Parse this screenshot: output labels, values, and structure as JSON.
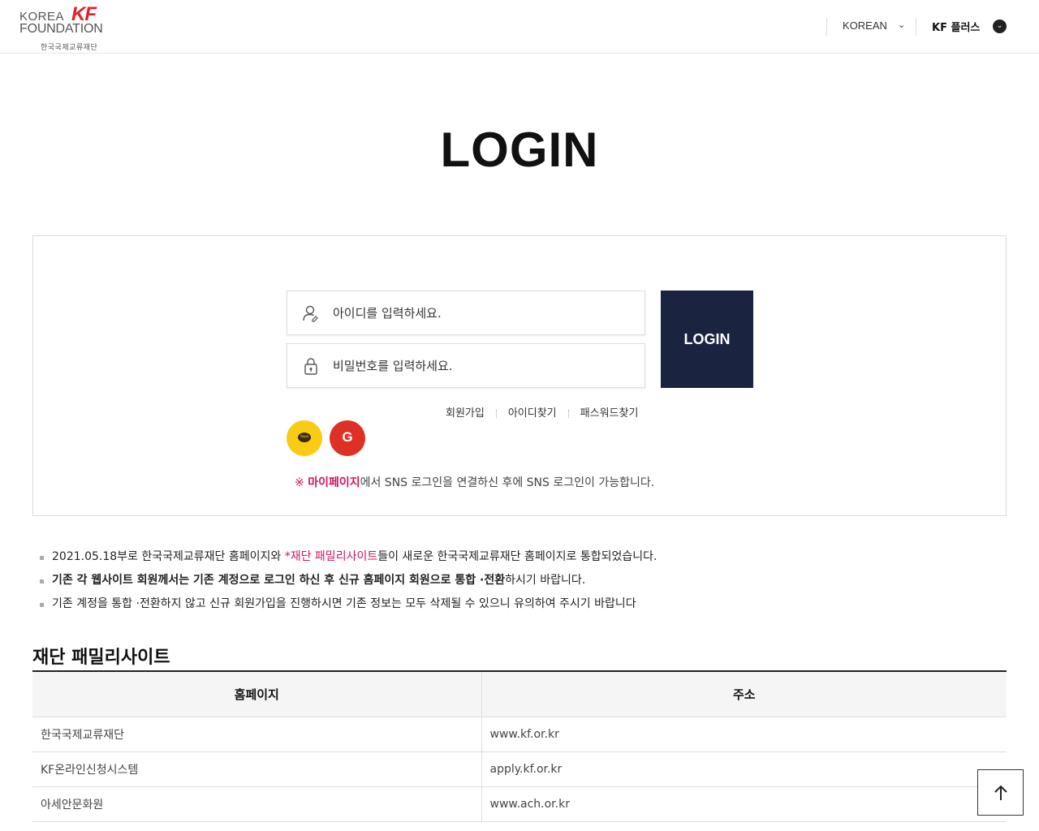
{
  "header": {
    "logo": {
      "en_line1": "KOREA",
      "en_line2": "FOUNDATION",
      "mark": "KF",
      "ko": "한국국제교류재단"
    },
    "language": "KOREAN",
    "kf_plus": "KF 플러스"
  },
  "page_title": "LOGIN",
  "login": {
    "id_placeholder": "아이디를 입력하세요.",
    "pw_placeholder": "비밀번호를 입력하세요.",
    "login_button": "LOGIN",
    "links": [
      "회원가입",
      "아이디찾기",
      "패스워드찾기"
    ],
    "sns": {
      "kakao_label": "TALK",
      "google_label": "G"
    },
    "notice_mark": "※",
    "notice_highlight": "마이페이지",
    "notice_text": "에서 SNS 로그인을 연결하신 후에 SNS 로그인이 가능합니다."
  },
  "bullets": {
    "b1_pre": "2021.05.18부로 한국국제교류재단 홈페이지와 ",
    "b1_link": "*재단 패밀리사이트",
    "b1_post": "들이 새로운 한국국제교류재단 홈페이지로 통합되었습니다.",
    "b2_bold": "기존 각 웹사이트 회원께서는 기존 계정으로 로그인 하신 후 신규 홈페이지 회원으로 통합 ·전환",
    "b2_post": "하시기 바랍니다.",
    "b3": "기존 계정을 통합 ·전환하지 않고 신규 회원가입을 진행하시면 기존 정보는 모두 삭제될 수 있으니 유의하여 주시기 바랍니다"
  },
  "family": {
    "title": "재단 패밀리사이트",
    "columns": [
      "홈페이지",
      "주소"
    ],
    "rows": [
      {
        "name": "한국국제교류재단",
        "url": "www.kf.or.kr"
      },
      {
        "name": "KF온라인신청시스템",
        "url": "apply.kf.or.kr"
      },
      {
        "name": "아세안문화원",
        "url": "www.ach.or.kr"
      }
    ]
  },
  "icons": {
    "user": "user-icon",
    "lock": "lock-icon",
    "chevron": "chevron-down-icon",
    "top": "arrow-up-icon"
  },
  "colors": {
    "login_button": "#1a2340",
    "accent": "#d1155f",
    "kakao": "#f9cc13",
    "google": "#de3025"
  }
}
